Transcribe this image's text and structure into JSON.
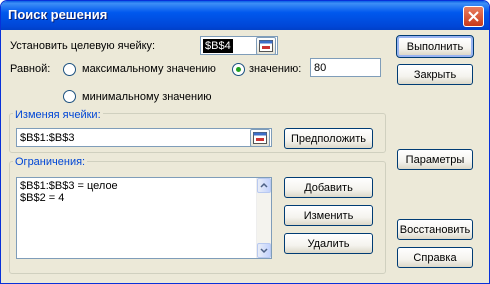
{
  "window": {
    "title": "Поиск решения"
  },
  "target": {
    "label": "Установить целевую ячейку:",
    "value": "$B$4"
  },
  "equal": {
    "label": "Равной:",
    "options": [
      "максимальному значению",
      "значению:",
      "минимальному значению"
    ],
    "selected": "значению:",
    "value": "80"
  },
  "changing": {
    "label": "Изменяя ячейки:",
    "value": "$B$1:$B$3",
    "guess_button": "Предположить"
  },
  "constraints": {
    "label": "Ограничения:",
    "items": [
      "$B$1:$B$3 = целое",
      "$B$2 = 4"
    ],
    "buttons": {
      "add": "Добавить",
      "change": "Изменить",
      "delete": "Удалить"
    }
  },
  "side_buttons": {
    "solve": "Выполнить",
    "close": "Закрыть",
    "options": "Параметры",
    "reset": "Восстановить",
    "help": "Справка"
  }
}
